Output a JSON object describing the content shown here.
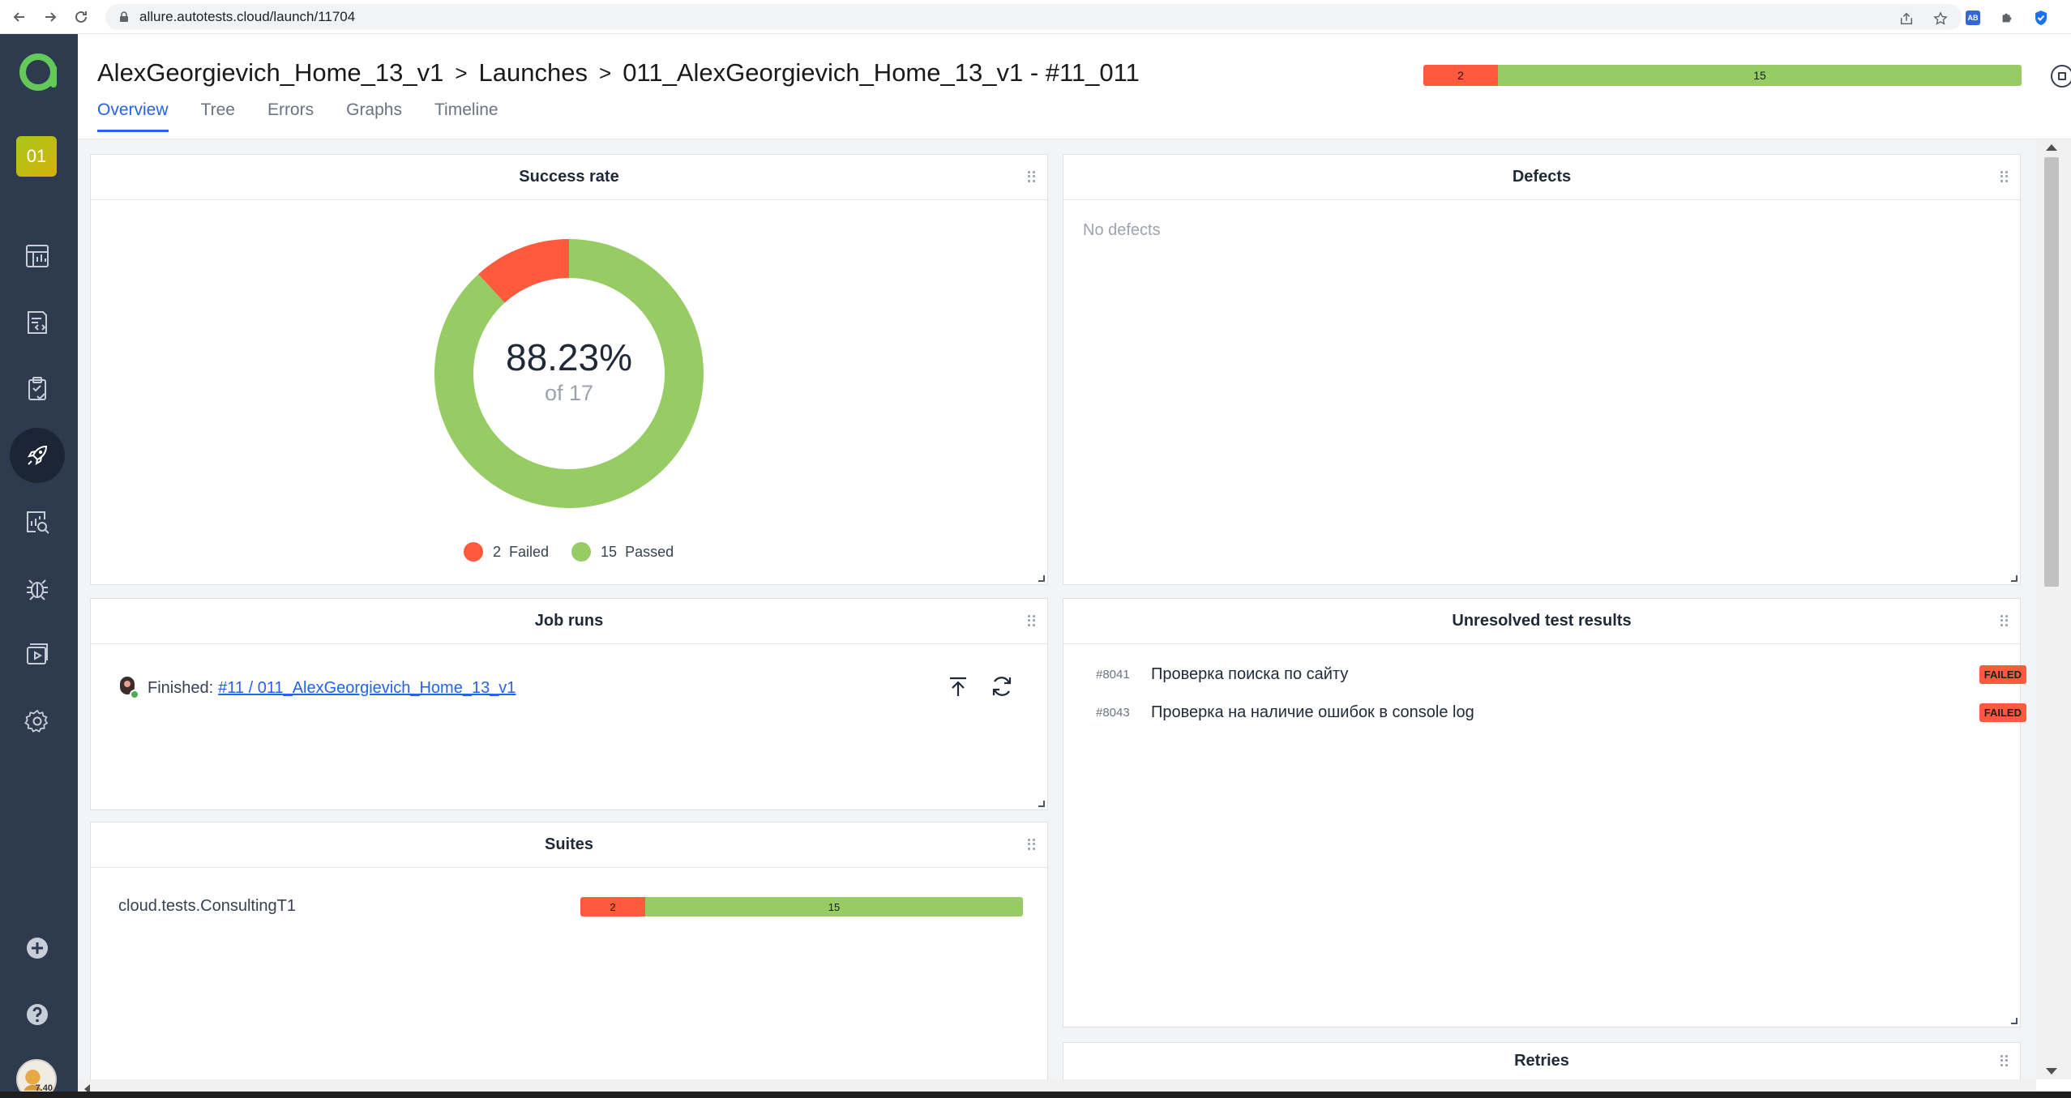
{
  "browser": {
    "url": "allure.autotests.cloud/launch/11704",
    "ext_ab": "AB"
  },
  "sidebar": {
    "project_badge": "01",
    "avatar_badge": "7.40",
    "items": [
      {
        "name": "dashboards"
      },
      {
        "name": "test-cases"
      },
      {
        "name": "test-plans"
      },
      {
        "name": "launches",
        "active": true
      },
      {
        "name": "analytics"
      },
      {
        "name": "defects"
      },
      {
        "name": "jobs"
      },
      {
        "name": "settings"
      }
    ]
  },
  "header": {
    "crumbs": [
      "AlexGeorgievich_Home_13_v1",
      "Launches",
      "011_AlexGeorgievich_Home_13_v1 - #11_011"
    ],
    "separator": ">",
    "tabs": [
      "Overview",
      "Tree",
      "Errors",
      "Graphs",
      "Timeline"
    ],
    "active_tab": "Overview",
    "stats": {
      "failed": "2",
      "passed": "15"
    }
  },
  "success_rate": {
    "title": "Success rate",
    "percent": "88.23%",
    "of_total": "of 17",
    "failed_count": "2",
    "failed_label": "Failed",
    "passed_count": "15",
    "passed_label": "Passed",
    "failed_value": 2,
    "passed_value": 15,
    "colors": {
      "failed": "#fd5a3e",
      "passed": "#97cc64"
    }
  },
  "defects": {
    "title": "Defects",
    "empty_text": "No defects"
  },
  "job_runs": {
    "title": "Job runs",
    "status_text": "Finished:",
    "link_text": "#11 / 011_AlexGeorgievich_Home_13_v1"
  },
  "unresolved": {
    "title": "Unresolved test results",
    "rows": [
      {
        "id": "#8041",
        "name": "Проверка поиска по сайту",
        "status": "FAILED"
      },
      {
        "id": "#8043",
        "name": "Проверка на наличие ошибок в console log",
        "status": "FAILED"
      }
    ]
  },
  "suites": {
    "title": "Suites",
    "rows": [
      {
        "name": "cloud.tests.ConsultingT1",
        "failed": "2",
        "passed": "15"
      }
    ]
  },
  "retries": {
    "title": "Retries"
  }
}
